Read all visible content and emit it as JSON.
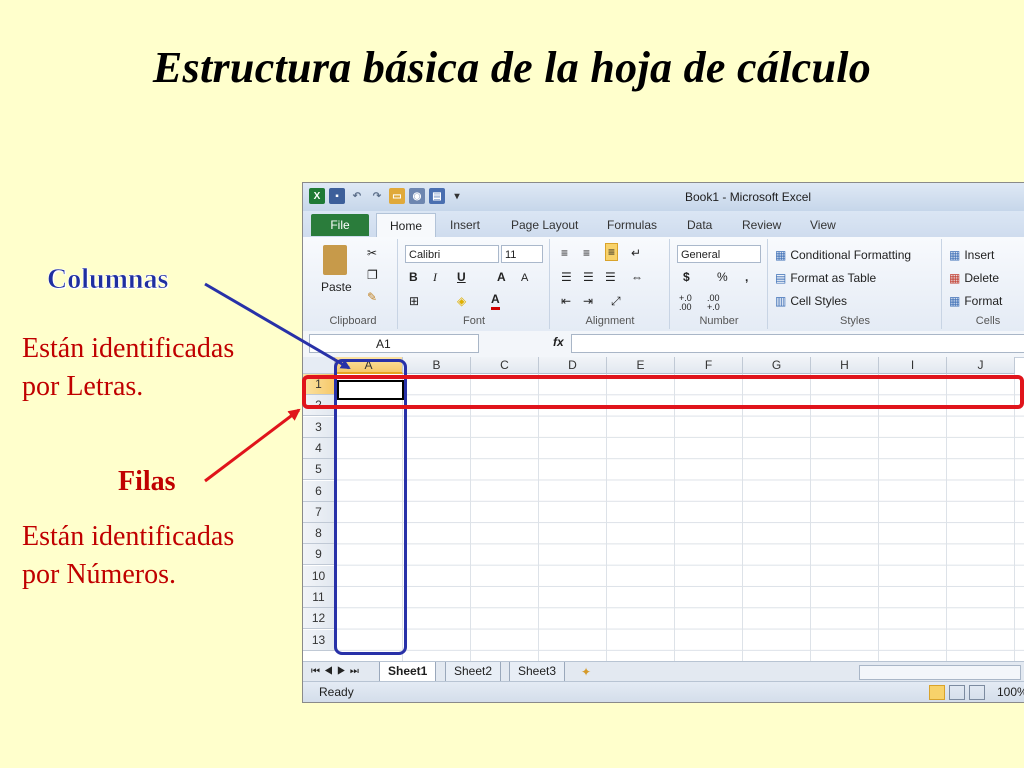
{
  "slide": {
    "title": "Estructura básica de la hoja de cálculo",
    "columns_heading": "Columnas",
    "columns_text_1": "Están identificadas",
    "columns_text_2": "por Letras.",
    "rows_heading": "Filas",
    "rows_text_1": "Están identificadas",
    "rows_text_2": "por Números.",
    "colors": {
      "background": "#FFFFCC",
      "blue": "#2831A8",
      "red": "#E0141B"
    }
  },
  "excel": {
    "window_title": "Book1  -  Microsoft Excel",
    "tabs": [
      "File",
      "Home",
      "Insert",
      "Page Layout",
      "Formulas",
      "Data",
      "Review",
      "View"
    ],
    "ribbon": {
      "clipboard": {
        "paste": "Paste",
        "label": "Clipboard"
      },
      "font": {
        "name": "Calibri",
        "size": "11",
        "bold": "B",
        "italic": "I",
        "underline": "U",
        "grow": "A",
        "shrink": "A",
        "color": "A",
        "label": "Font"
      },
      "alignment": {
        "label": "Alignment"
      },
      "number": {
        "format": "General",
        "currency": "$",
        "percent": "%",
        "comma": ",",
        "inc": "+.0 .00",
        "dec": ".00 +.0",
        "label": "Number"
      },
      "styles": {
        "conditional": "Conditional Formatting",
        "table": "Format as Table",
        "cell": "Cell Styles",
        "label": "Styles"
      },
      "cells": {
        "insert": "Insert",
        "delete": "Delete",
        "format": "Format",
        "label": "Cells"
      }
    },
    "name_box": "A1",
    "fx": "fx",
    "columns": [
      "A",
      "B",
      "C",
      "D",
      "E",
      "F",
      "G",
      "H",
      "I",
      "J"
    ],
    "rows": [
      "1",
      "2",
      "3",
      "4",
      "5",
      "6",
      "7",
      "8",
      "9",
      "10",
      "11",
      "12",
      "13"
    ],
    "sheets": [
      "Sheet1",
      "Sheet2",
      "Sheet3"
    ],
    "status": "Ready",
    "zoom": "100%"
  }
}
